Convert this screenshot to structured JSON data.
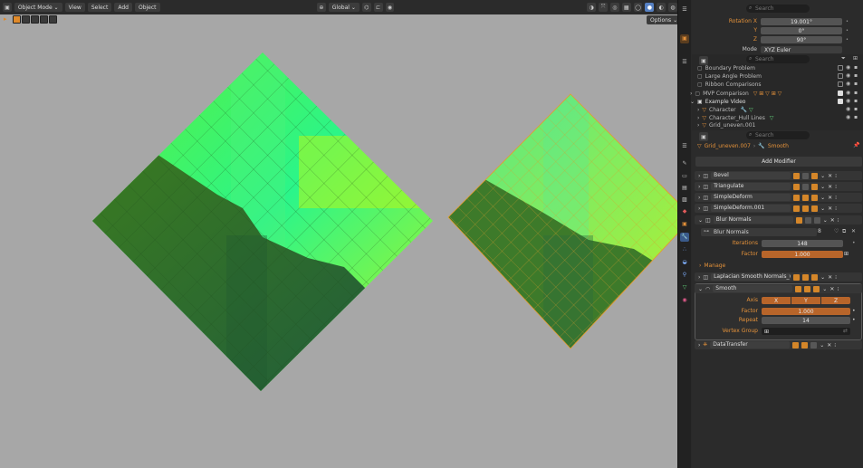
{
  "header": {
    "mode_label": "Object Mode",
    "menus": [
      "View",
      "Select",
      "Add",
      "Object"
    ],
    "orientation_label": "Global",
    "options_label": "Options"
  },
  "colors": {
    "viewport_bg": "#a7a7a7",
    "accent_orange": "#e3913a",
    "field_fill": "#b8652a",
    "mesh_bright": "#2bf58a",
    "mesh_lime": "#b7f51c",
    "mesh_dark": "#2f6a24"
  },
  "properties": {
    "search_placeholder": "Search",
    "rotation_x_label": "Rotation X",
    "rotation_x_value": "19.001°",
    "rotation_y_label": "Y",
    "rotation_y_value": "0°",
    "rotation_z_label": "Z",
    "rotation_z_value": "90°",
    "mode_label": "Mode",
    "mode_value": "XYZ Euler"
  },
  "outliner": {
    "search_placeholder": "Search",
    "items": [
      {
        "label": "Boundary Problem"
      },
      {
        "label": "Large Angle Problem"
      },
      {
        "label": "Ribbon Comparisons"
      },
      {
        "label": "MVP Comparison"
      },
      {
        "label": "Example Video"
      },
      {
        "label": "Character"
      },
      {
        "label": "Character_Hull Lines"
      },
      {
        "label": "Grid_uneven.001"
      }
    ]
  },
  "modifiers_panel": {
    "breadcrumb_object": "Grid_uneven.007",
    "breadcrumb_modifier": "Smooth",
    "search_placeholder": "Search",
    "add_modifier_label": "Add Modifier",
    "modifiers": [
      {
        "name": "Bevel"
      },
      {
        "name": "Triangulate"
      },
      {
        "name": "SimpleDeform"
      },
      {
        "name": "SimpleDeform.001"
      },
      {
        "name": "Blur Normals"
      }
    ],
    "blur_normals": {
      "node_group": "Blur Normals",
      "users": "8",
      "iterations_label": "Iterations",
      "iterations_value": "148",
      "factor_label": "Factor",
      "factor_value": "1.000",
      "manage_label": "Manage"
    },
    "laplacian_name": "Laplacian Smooth Normals_v1.0.0",
    "smooth": {
      "name": "Smooth",
      "axis_label": "Axis",
      "axis_x": "X",
      "axis_y": "Y",
      "axis_z": "Z",
      "factor_label": "Factor",
      "factor_value": "1.000",
      "repeat_label": "Repeat",
      "repeat_value": "14",
      "vertex_group_label": "Vertex Group"
    },
    "data_transfer_name": "DataTransfer"
  }
}
